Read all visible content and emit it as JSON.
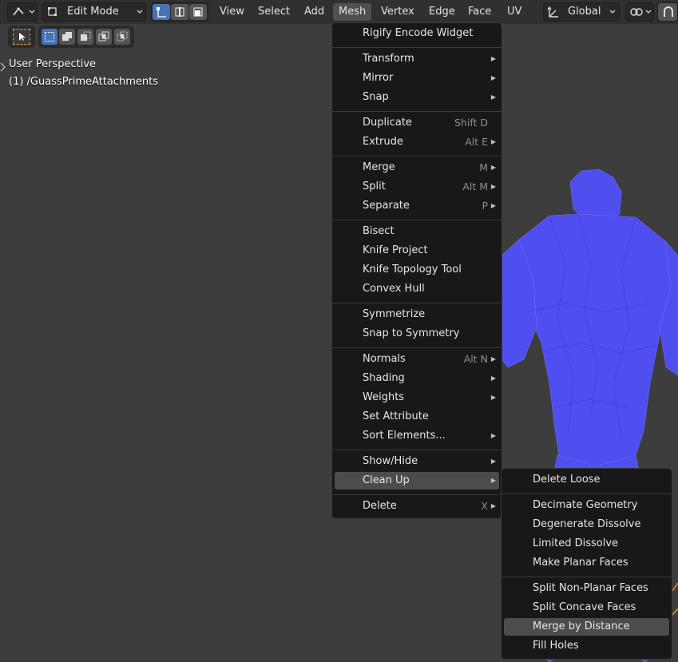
{
  "header": {
    "mode": "Edit Mode",
    "menus": [
      "View",
      "Select",
      "Add",
      "Mesh",
      "Vertex",
      "Edge",
      "Face",
      "UV"
    ],
    "transform_orientation": "Global"
  },
  "viewport": {
    "perspective_label": "User Perspective",
    "object_label": "(1) /GuassPrimeAttachments"
  },
  "mesh_menu": {
    "groups": [
      [
        {
          "label": "Rigify Encode Widget",
          "shortcut": "",
          "submenu": false
        }
      ],
      [
        {
          "label": "Transform",
          "shortcut": "",
          "submenu": true
        },
        {
          "label": "Mirror",
          "shortcut": "",
          "submenu": true
        },
        {
          "label": "Snap",
          "shortcut": "",
          "submenu": true
        }
      ],
      [
        {
          "label": "Duplicate",
          "shortcut": "Shift D",
          "submenu": false
        },
        {
          "label": "Extrude",
          "shortcut": "Alt E",
          "submenu": true
        }
      ],
      [
        {
          "label": "Merge",
          "shortcut": "M",
          "submenu": true
        },
        {
          "label": "Split",
          "shortcut": "Alt M",
          "submenu": true
        },
        {
          "label": "Separate",
          "shortcut": "P",
          "submenu": true
        }
      ],
      [
        {
          "label": "Bisect",
          "shortcut": "",
          "submenu": false
        },
        {
          "label": "Knife Project",
          "shortcut": "",
          "submenu": false
        },
        {
          "label": "Knife Topology Tool",
          "shortcut": "",
          "submenu": false
        },
        {
          "label": "Convex Hull",
          "shortcut": "",
          "submenu": false
        }
      ],
      [
        {
          "label": "Symmetrize",
          "shortcut": "",
          "submenu": false
        },
        {
          "label": "Snap to Symmetry",
          "shortcut": "",
          "submenu": false
        }
      ],
      [
        {
          "label": "Normals",
          "shortcut": "Alt N",
          "submenu": true
        },
        {
          "label": "Shading",
          "shortcut": "",
          "submenu": true
        },
        {
          "label": "Weights",
          "shortcut": "",
          "submenu": true
        },
        {
          "label": "Set Attribute",
          "shortcut": "",
          "submenu": false
        },
        {
          "label": "Sort Elements...",
          "shortcut": "",
          "submenu": true
        }
      ],
      [
        {
          "label": "Show/Hide",
          "shortcut": "",
          "submenu": true
        },
        {
          "label": "Clean Up",
          "shortcut": "",
          "submenu": true,
          "highlighted": true
        }
      ],
      [
        {
          "label": "Delete",
          "shortcut": "X",
          "submenu": true
        }
      ]
    ]
  },
  "cleanup_menu": {
    "groups": [
      [
        {
          "label": "Delete Loose"
        }
      ],
      [
        {
          "label": "Decimate Geometry"
        },
        {
          "label": "Degenerate Dissolve"
        },
        {
          "label": "Limited Dissolve"
        },
        {
          "label": "Make Planar Faces"
        }
      ],
      [
        {
          "label": "Split Non-Planar Faces"
        },
        {
          "label": "Split Concave Faces"
        },
        {
          "label": "Merge by Distance",
          "highlighted": true
        },
        {
          "label": "Fill Holes"
        }
      ]
    ]
  },
  "colors": {
    "accent": "#4772b3",
    "mesh": "#5555f5",
    "selection": "#ff8c1a"
  }
}
